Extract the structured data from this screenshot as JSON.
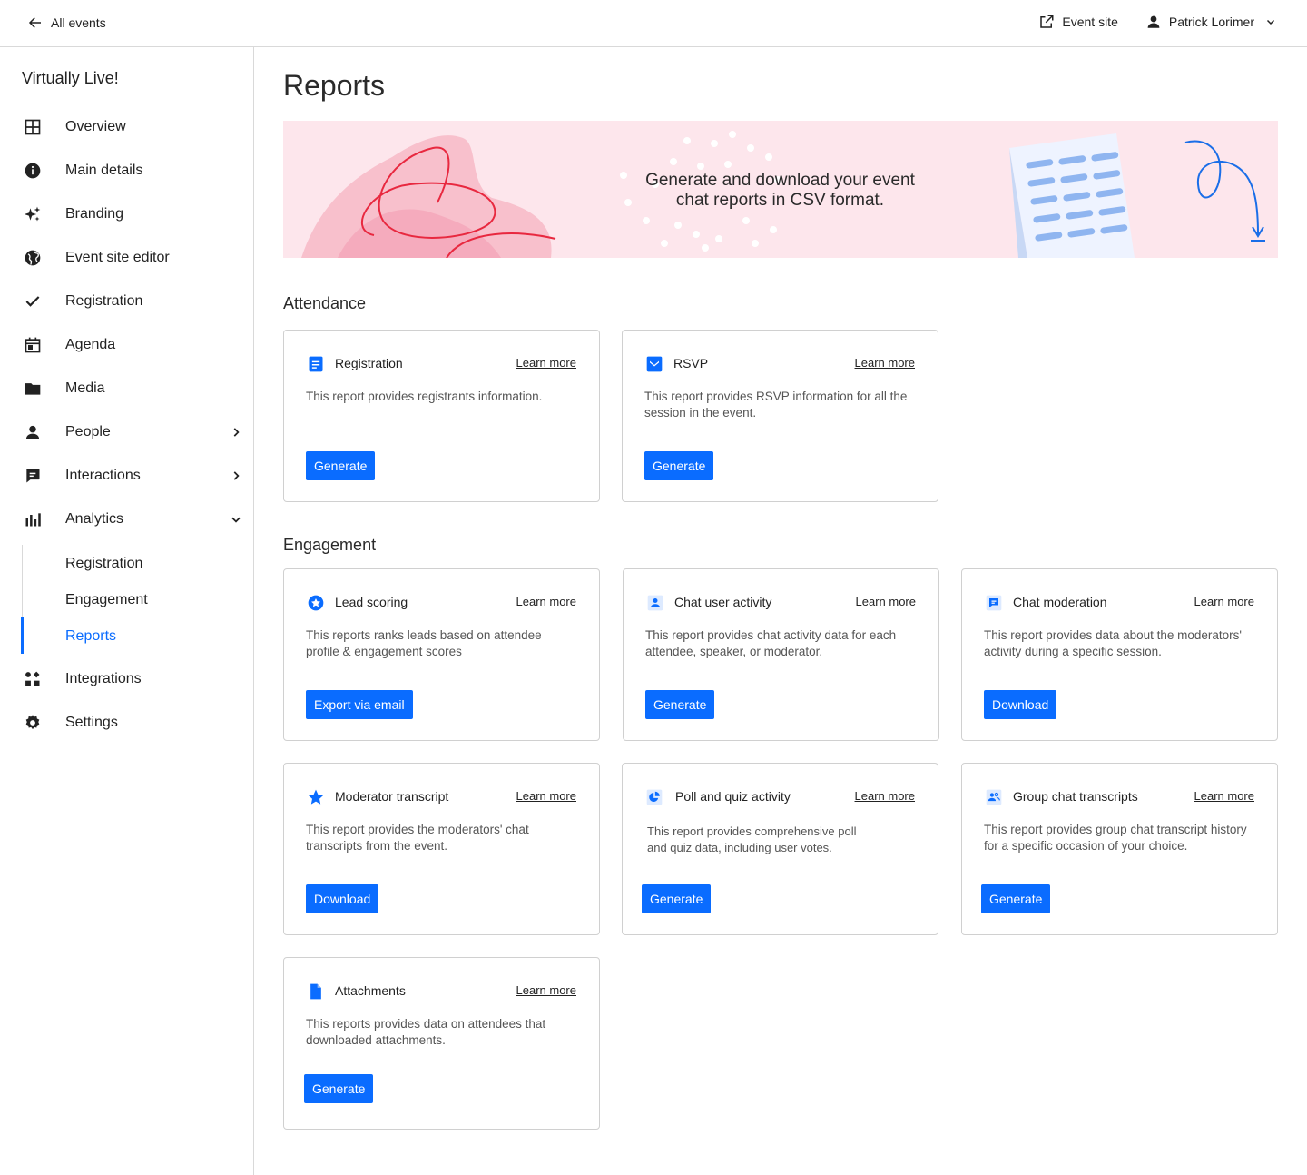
{
  "topbar": {
    "back_label": "All events",
    "event_site_label": "Event site",
    "user_name": "Patrick Lorimer"
  },
  "sidebar": {
    "event_name": "Virtually Live!",
    "items": [
      {
        "label": "Overview",
        "icon": "grid-icon"
      },
      {
        "label": "Main details",
        "icon": "info-icon"
      },
      {
        "label": "Branding",
        "icon": "sparkle-icon"
      },
      {
        "label": "Event site editor",
        "icon": "globe-icon"
      },
      {
        "label": "Registration",
        "icon": "check-icon"
      },
      {
        "label": "Agenda",
        "icon": "calendar-icon"
      },
      {
        "label": "Media",
        "icon": "folder-icon"
      },
      {
        "label": "People",
        "icon": "person-icon"
      },
      {
        "label": "Interactions",
        "icon": "chat-icon"
      },
      {
        "label": "Analytics",
        "icon": "bar-chart-icon"
      },
      {
        "label": "Integrations",
        "icon": "apps-icon"
      },
      {
        "label": "Settings",
        "icon": "gear-icon"
      }
    ],
    "analytics_sub": [
      {
        "label": "Registration"
      },
      {
        "label": "Engagement"
      },
      {
        "label": "Reports"
      }
    ]
  },
  "main": {
    "title": "Reports",
    "banner_text": "Generate and download your event chat reports in CSV format.",
    "attendance_title": "Attendance",
    "engagement_title": "Engagement",
    "learn_more": "Learn more",
    "attendance": [
      {
        "title": "Registration",
        "desc": "This report provides registrants information.",
        "button": "Generate",
        "icon": "document-icon"
      },
      {
        "title": "RSVP",
        "desc": "This report provides RSVP information for all the session in the event.",
        "button": "Generate",
        "icon": "mail-icon"
      }
    ],
    "engagement": [
      {
        "title": "Lead scoring",
        "desc": "This reports ranks leads based on attendee profile & engagement scores",
        "button": "Export via email",
        "icon": "badge-icon"
      },
      {
        "title": "Chat user activity",
        "desc": "This report provides chat activity data for each attendee, speaker, or moderator.",
        "button": "Generate",
        "icon": "user-icon"
      },
      {
        "title": "Chat moderation",
        "desc": "This report provides data about the moderators' activity during a specific session.",
        "button": "Download",
        "icon": "chat-bubble-icon"
      },
      {
        "title": "Moderator transcript",
        "desc": "This report provides the moderators' chat transcripts from the event.",
        "button": "Download",
        "icon": "star-icon"
      },
      {
        "title": "Poll and quiz activity",
        "desc": "This report provides comprehensive poll and quiz data, including user votes.",
        "button": "Generate",
        "icon": "pie-icon"
      },
      {
        "title": "Group chat transcripts",
        "desc": "This report provides group chat transcript history for a specific occasion of your choice.",
        "button": "Generate",
        "icon": "group-icon"
      },
      {
        "title": "Attachments",
        "desc": "This reports provides data on attendees that downloaded attachments.",
        "button": "Generate",
        "icon": "file-icon"
      }
    ]
  },
  "colors": {
    "accent": "#0a6cff",
    "banner_bg": "#fde6ec"
  }
}
